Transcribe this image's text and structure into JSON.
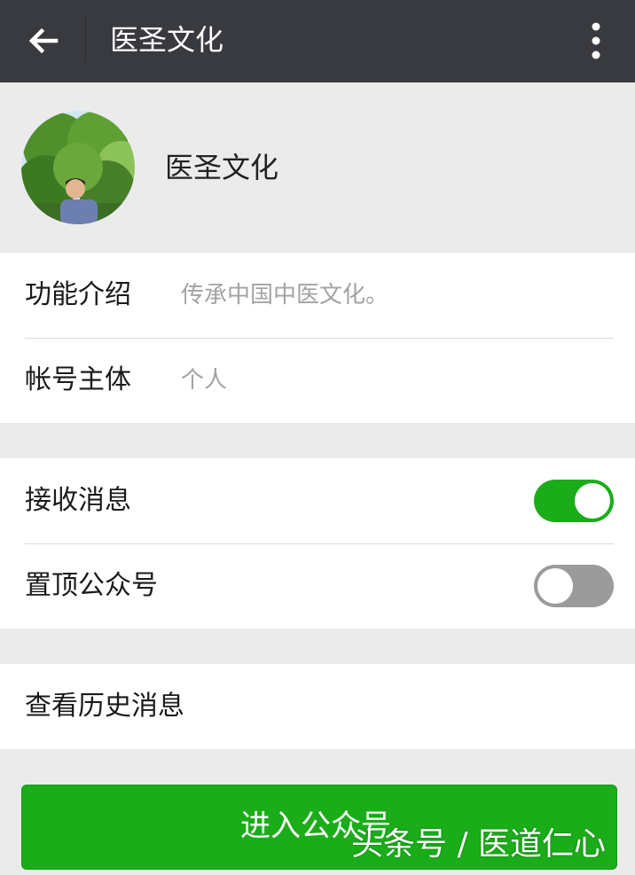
{
  "header": {
    "title": "医圣文化",
    "back_icon": "arrow-left-icon",
    "more_icon": "more-vertical-icon"
  },
  "profile": {
    "name": "医圣文化",
    "avatar": "profile-photo"
  },
  "info": [
    {
      "label": "功能介绍",
      "value": "传承中国中医文化。"
    },
    {
      "label": "帐号主体",
      "value": "个人"
    }
  ],
  "settings": [
    {
      "label": "接收消息",
      "enabled": true
    },
    {
      "label": "置顶公众号",
      "enabled": false
    }
  ],
  "history": {
    "label": "查看历史消息"
  },
  "enter_button": {
    "label": "进入公众号"
  },
  "watermark": "头条号 / 医道仁心",
  "colors": {
    "header_bg": "#393a3f",
    "page_bg": "#ebebeb",
    "accent_green": "#1aad19",
    "toggle_off": "#9b9b9b"
  }
}
